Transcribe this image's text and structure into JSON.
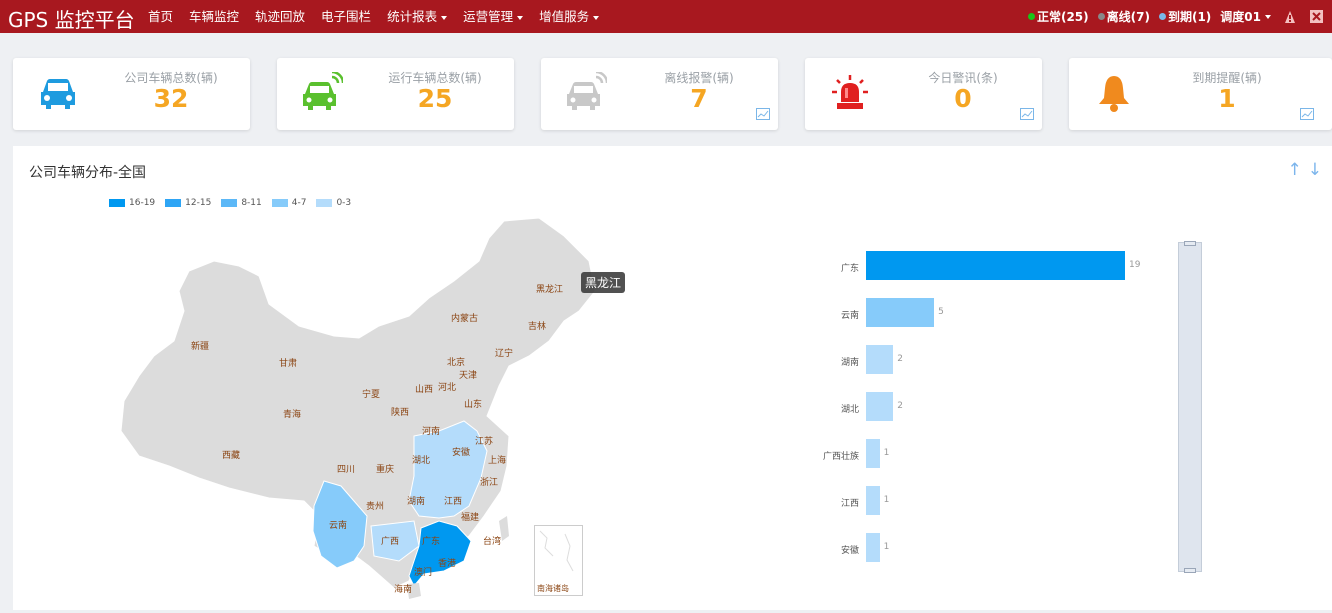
{
  "header": {
    "brand": "GPS 监控平台",
    "nav": [
      {
        "label": "首页",
        "dropdown": false
      },
      {
        "label": "车辆监控",
        "dropdown": false
      },
      {
        "label": "轨迹回放",
        "dropdown": false
      },
      {
        "label": "电子围栏",
        "dropdown": false
      },
      {
        "label": "统计报表",
        "dropdown": true
      },
      {
        "label": "运营管理",
        "dropdown": true
      },
      {
        "label": "增值服务",
        "dropdown": true
      }
    ],
    "status": {
      "normal": "正常(25)",
      "offline": "离线(7)",
      "expired": "到期(1)",
      "user": "调度01"
    },
    "colors": {
      "bar": "#a8181f",
      "normal": "#18c418",
      "offline": "#888888",
      "expired": "#7ab6e8"
    }
  },
  "cards": [
    {
      "label": "公司车辆总数(辆)",
      "value": "32",
      "icon": "car-icon",
      "color": "#1e9bdf"
    },
    {
      "label": "运行车辆总数(辆)",
      "value": "25",
      "icon": "car-signal-icon",
      "color": "#5ac02e"
    },
    {
      "label": "离线报警(辆)",
      "value": "7",
      "icon": "car-signal-icon",
      "color": "#c8c8c8"
    },
    {
      "label": "今日警讯(条)",
      "value": "0",
      "icon": "alarm-light-icon",
      "color": "#e02020"
    },
    {
      "label": "到期提醒(辆)",
      "value": "1",
      "icon": "bell-icon",
      "color": "#f08a1e"
    }
  ],
  "panel": {
    "title": "公司车辆分布-全国",
    "legend": [
      {
        "label": "16-19",
        "color": "#0098f0"
      },
      {
        "label": "12-15",
        "color": "#2ea5f5"
      },
      {
        "label": "8-11",
        "color": "#5cb8f7"
      },
      {
        "label": "4-7",
        "color": "#86cbfa"
      },
      {
        "label": "0-3",
        "color": "#b4dcfb"
      }
    ],
    "tooltip": "黑龙江",
    "nanhai_label": "南海诸岛",
    "provinces": [
      "黑龙江",
      "内蒙古",
      "吉林",
      "新疆",
      "辽宁",
      "甘肃",
      "北京",
      "天津",
      "宁夏",
      "山西",
      "河北",
      "青海",
      "陕西",
      "山东",
      "河南",
      "江苏",
      "西藏",
      "湖北",
      "安徽",
      "上海",
      "四川",
      "重庆",
      "浙江",
      "贵州",
      "湖南",
      "江西",
      "云南",
      "福建",
      "广西",
      "广东",
      "台湾",
      "澳门",
      "香港",
      "海南"
    ]
  },
  "chart_data": {
    "type": "bar",
    "orientation": "horizontal",
    "categories": [
      "广东",
      "云南",
      "湖南",
      "湖北",
      "广西壮族",
      "江西",
      "安徽"
    ],
    "values": [
      19,
      5,
      2,
      2,
      1,
      1,
      1
    ],
    "max": 19,
    "colors": [
      "#0098f0",
      "#86cbfa",
      "#b4dcfb",
      "#b4dcfb",
      "#b4dcfb",
      "#b4dcfb",
      "#b4dcfb"
    ]
  }
}
